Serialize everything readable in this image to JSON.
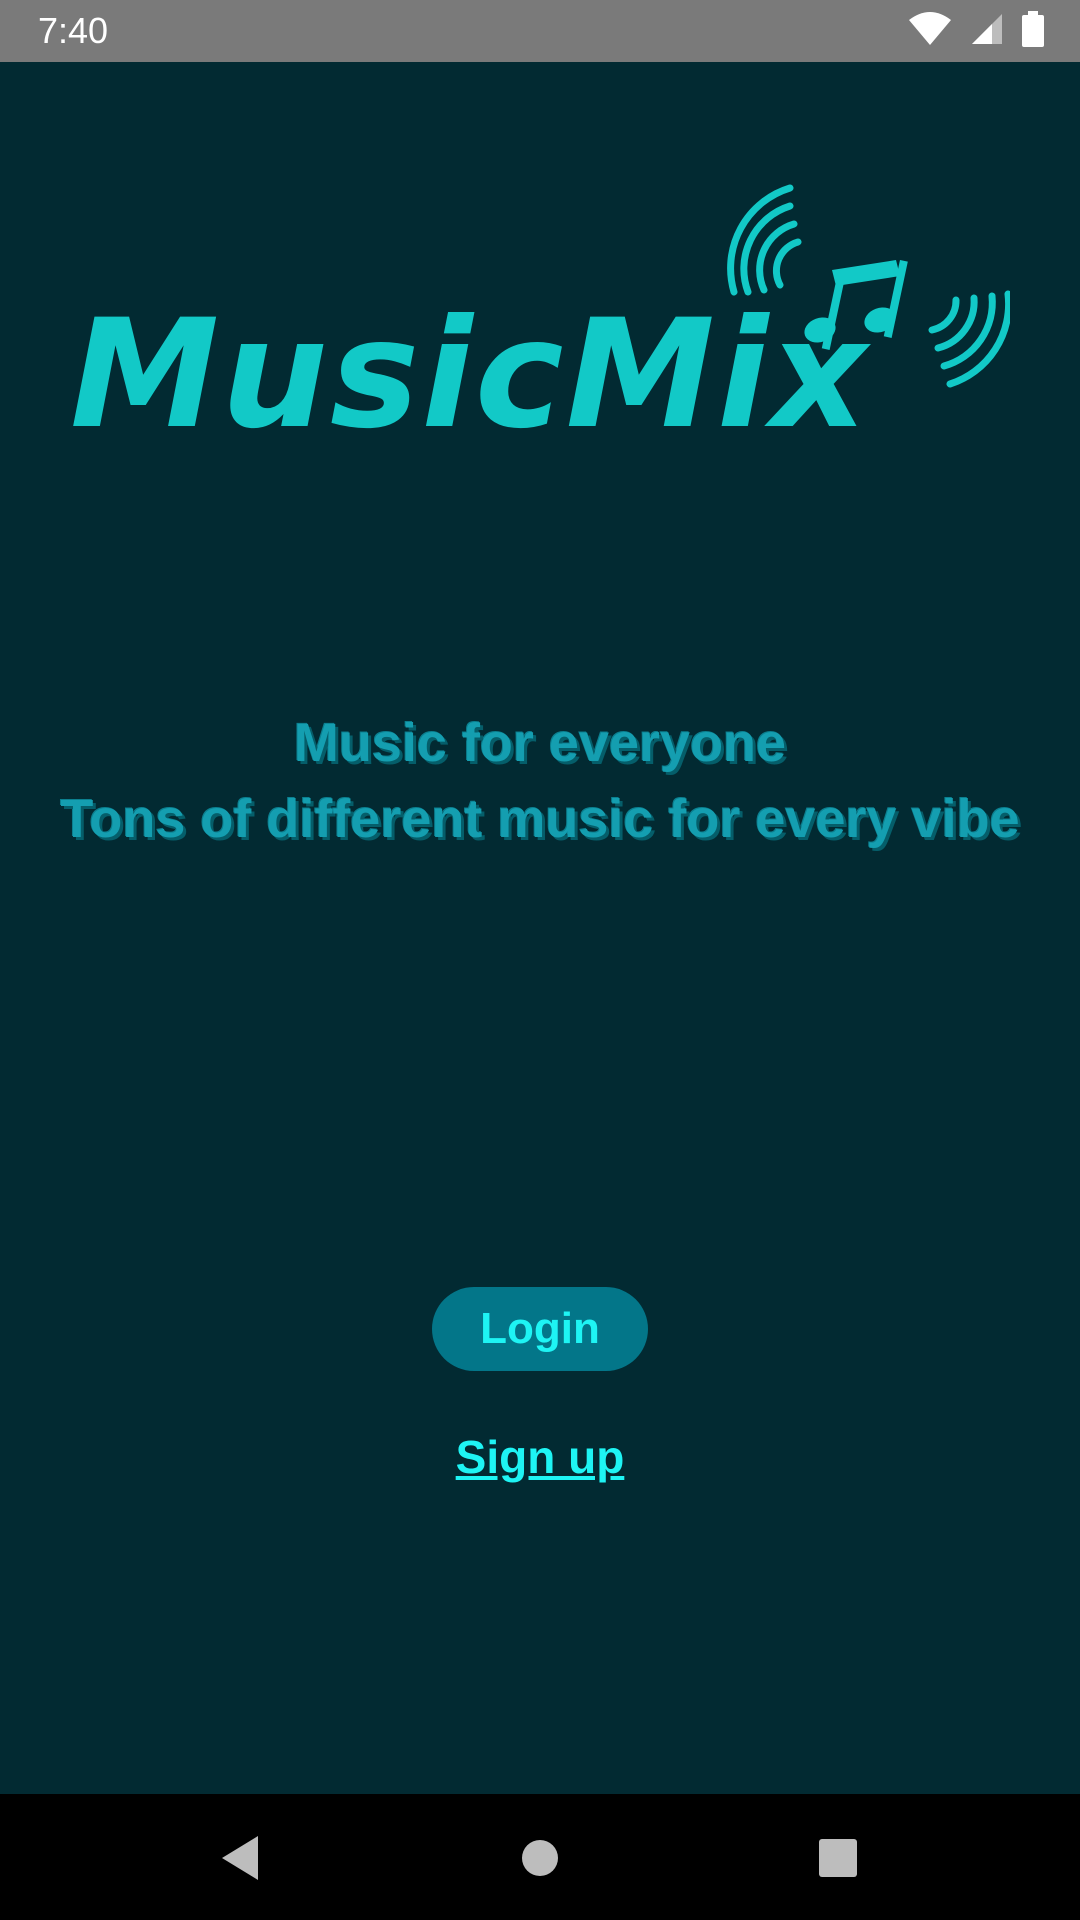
{
  "status_bar": {
    "time": "7:40",
    "icons": [
      "wifi-icon",
      "cellular-signal-icon",
      "battery-icon"
    ]
  },
  "logo": {
    "text": "MusicMix",
    "icon": "music-note-sound-waves-icon"
  },
  "tagline": {
    "line1": "Music for everyone",
    "line2": "Tons of different music for every vibe"
  },
  "actions": {
    "login_label": "Login",
    "signup_label": "Sign up"
  },
  "nav_bar": {
    "icons": [
      "back-icon",
      "home-icon",
      "recents-icon"
    ]
  },
  "colors": {
    "background": "#022a32",
    "accent": "#12c9c7",
    "button": "#037689",
    "button_text": "#1ef4f4",
    "status_bar": "#7a7a7a"
  }
}
